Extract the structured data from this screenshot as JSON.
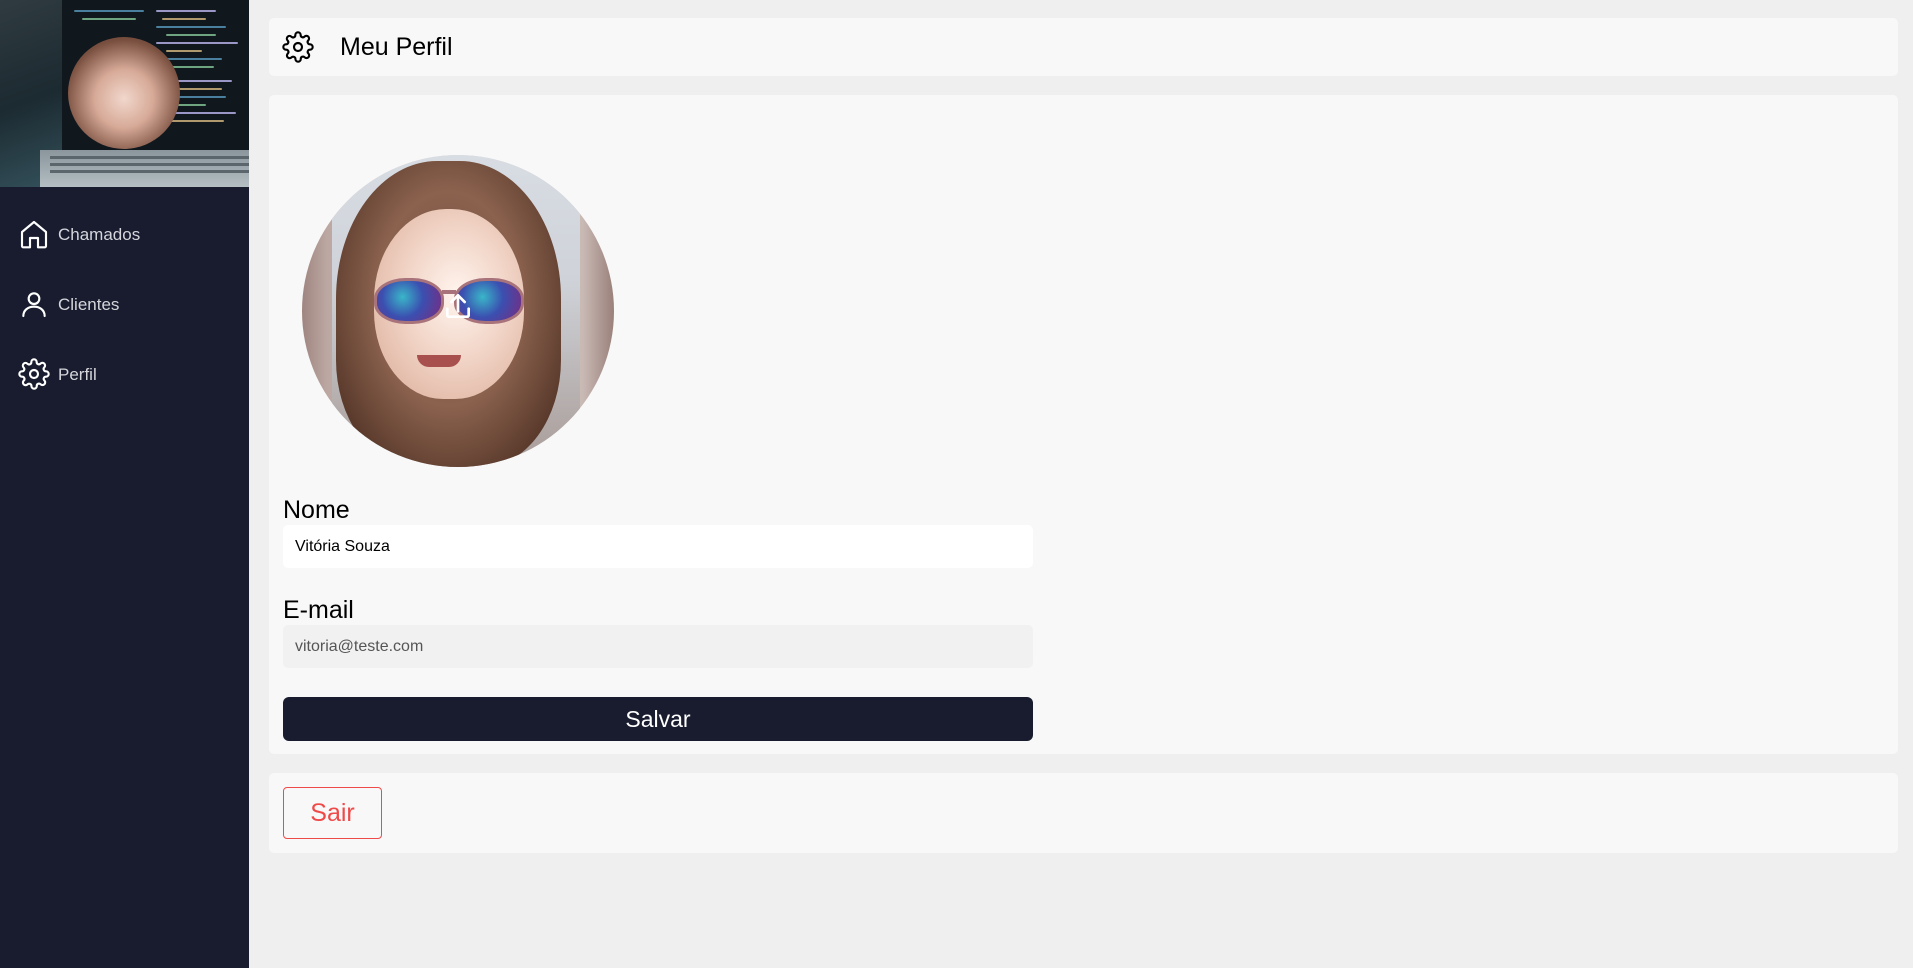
{
  "sidebar": {
    "avatar_alt": "avatar",
    "items": [
      {
        "label": "Chamados",
        "icon": "home-icon"
      },
      {
        "label": "Clientes",
        "icon": "user-icon"
      },
      {
        "label": "Perfil",
        "icon": "gear-icon"
      }
    ]
  },
  "header": {
    "title": "Meu Perfil",
    "icon": "gear-icon"
  },
  "profile": {
    "upload_icon": "upload-icon",
    "name_label": "Nome",
    "name_value": "Vitória Souza",
    "email_label": "E-mail",
    "email_value": "vitoria@teste.com",
    "save_label": "Salvar"
  },
  "logout": {
    "label": "Sair"
  },
  "colors": {
    "sidebar_bg": "#181c2e",
    "primary_button": "#181c2e",
    "danger": "#ef4a4a",
    "page_bg": "#efefef",
    "card_bg": "#f8f8f8"
  }
}
